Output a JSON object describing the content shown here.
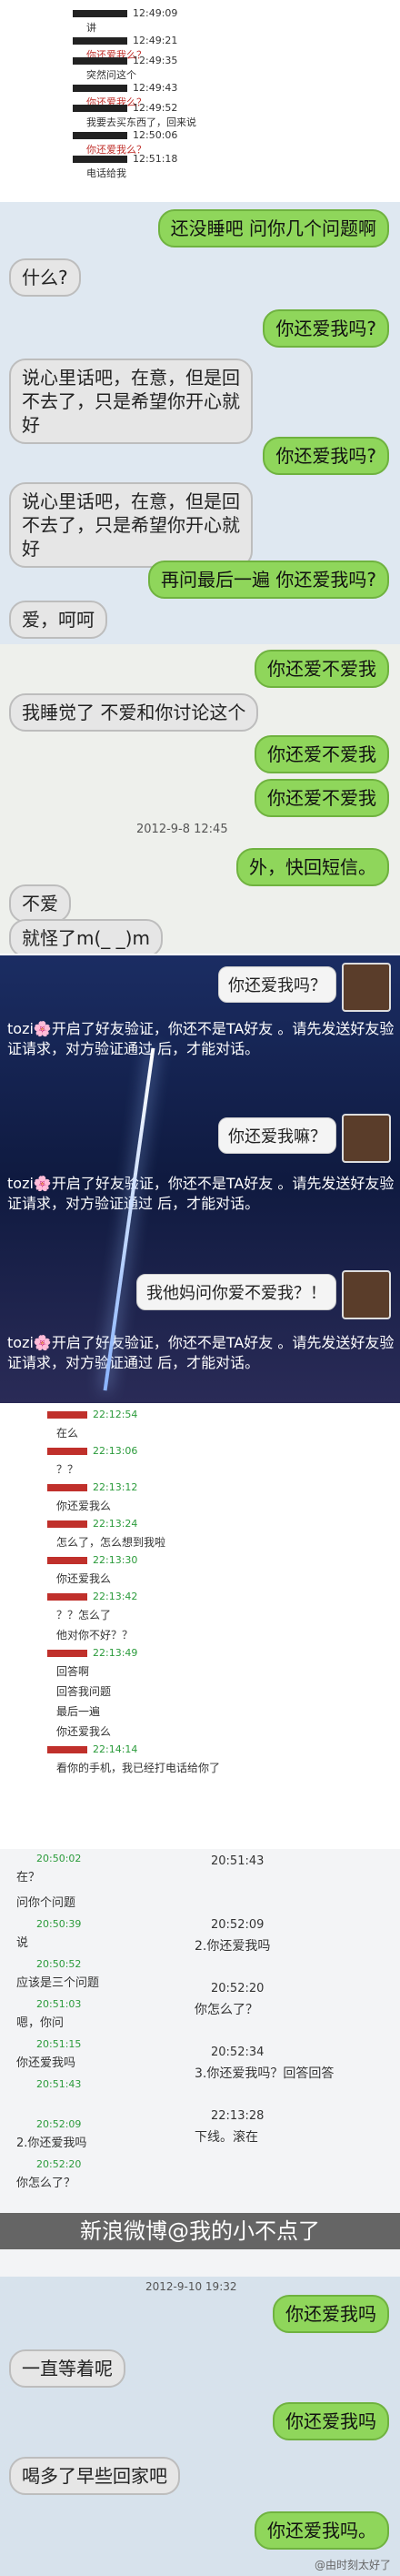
{
  "panel1": {
    "lines": [
      {
        "time": "12:49:09",
        "text": "讲"
      },
      {
        "time": "12:49:21",
        "text": "你还爱我么？"
      },
      {
        "time": "12:49:35",
        "text": "突然问这个"
      },
      {
        "time": "12:49:43",
        "text": "你还爱我么？"
      },
      {
        "time": "12:49:52",
        "text": "我要去买东西了，回来说"
      },
      {
        "time": "12:50:06",
        "text": "你还爱我么？"
      },
      {
        "time": "12:51:18",
        "text": "电话给我"
      }
    ]
  },
  "panel2": {
    "messages": [
      {
        "side": "out",
        "text": "还没睡吧 问你几个问题啊"
      },
      {
        "side": "in",
        "text": "什么?"
      },
      {
        "side": "out",
        "text": "你还爱我吗?"
      },
      {
        "side": "in",
        "text": "说心里话吧，在意，但是回\n不去了，只是希望你开心就\n好"
      },
      {
        "side": "out",
        "text": "你还爱我吗?"
      },
      {
        "side": "in",
        "text": "说心里话吧，在意，但是回\n不去了，只是希望你开心就\n好"
      },
      {
        "side": "out",
        "text": "再问最后一遍 你还爱我吗?"
      },
      {
        "side": "in",
        "text": "爱，呵呵"
      }
    ]
  },
  "panel3": {
    "timestamp": "2012-9-8 12:45",
    "messages": [
      {
        "side": "out",
        "text": "你还爱不爱我"
      },
      {
        "side": "in",
        "text": "我睡觉了 不爱和你讨论这个"
      },
      {
        "side": "out",
        "text": "你还爱不爱我"
      },
      {
        "side": "out",
        "text": "你还爱不爱我"
      },
      {
        "side": "out",
        "text": "外，快回短信。"
      },
      {
        "side": "in",
        "text": "不爱"
      },
      {
        "side": "in",
        "text": "就怪了m(_ _)m"
      }
    ]
  },
  "panel4": {
    "bubbles": [
      "你还爱我吗？",
      "你还爱我嘛？",
      "我他妈问你爱不爱我？！"
    ],
    "system": "tozi🌸开启了好友验证，你还不是TA好友\n。请先发送好友验证请求，对方验证通过\n后，才能对话。"
  },
  "panel5": {
    "lines": [
      {
        "time": "22:12:54",
        "text": "在么"
      },
      {
        "time": "22:13:06",
        "text": "？？"
      },
      {
        "time": "22:13:12",
        "text": "你还爱我么"
      },
      {
        "time": "22:13:24",
        "text": "怎么了，怎么想到我啦"
      },
      {
        "time": "22:13:30",
        "text": "你还爱我么"
      },
      {
        "time": "22:13:42",
        "text": "？？怎么了"
      },
      {
        "time": "",
        "text": "他对你不好？？"
      },
      {
        "time": "22:13:49",
        "text": "回答啊"
      },
      {
        "time": "",
        "text": "回答我问题"
      },
      {
        "time": "",
        "text": "最后一遍"
      },
      {
        "time": "",
        "text": "你还爱我么"
      },
      {
        "time": "22:14:14",
        "text": "看你的手机，我已经打电话给你了"
      }
    ]
  },
  "panel6": {
    "left": [
      {
        "time": "20:50:02",
        "text": "在？"
      },
      {
        "time": "",
        "text": "问你个问题"
      },
      {
        "time": "20:50:39",
        "text": "说"
      },
      {
        "time": "20:50:52",
        "text": "应该是三个问题"
      },
      {
        "time": "20:51:03",
        "text": "嗯，你问"
      },
      {
        "time": "20:51:15",
        "text": "你还爱我吗"
      },
      {
        "time": "20:51:43",
        "text": ""
      },
      {
        "time": "20:52:09",
        "text": "2.你还爱我吗"
      },
      {
        "time": "20:52:20",
        "text": "你怎么了？"
      }
    ],
    "right": [
      {
        "time": "20:51:43",
        "text": ""
      },
      {
        "time": "20:52:09",
        "text": "2.你还爱我吗"
      },
      {
        "time": "20:52:20",
        "text": "你怎么了？"
      },
      {
        "time": "20:52:34",
        "text": "3.你还爱我吗？回答回答"
      },
      {
        "time": "22:13:28",
        "text": "下线。滚在"
      }
    ],
    "watermark": "新浪微博@我的小不点了"
  },
  "panel7": {
    "header": "2012-9-10 19:32",
    "messages": [
      {
        "side": "out",
        "text": "你还爱我吗"
      },
      {
        "side": "in",
        "text": "一直等着呢"
      },
      {
        "side": "out",
        "text": "你还爱我吗"
      },
      {
        "side": "in",
        "text": "喝多了早些回家吧"
      },
      {
        "side": "out",
        "text": "你还爱我吗。"
      }
    ],
    "weibo": "@由时刻太好了"
  }
}
